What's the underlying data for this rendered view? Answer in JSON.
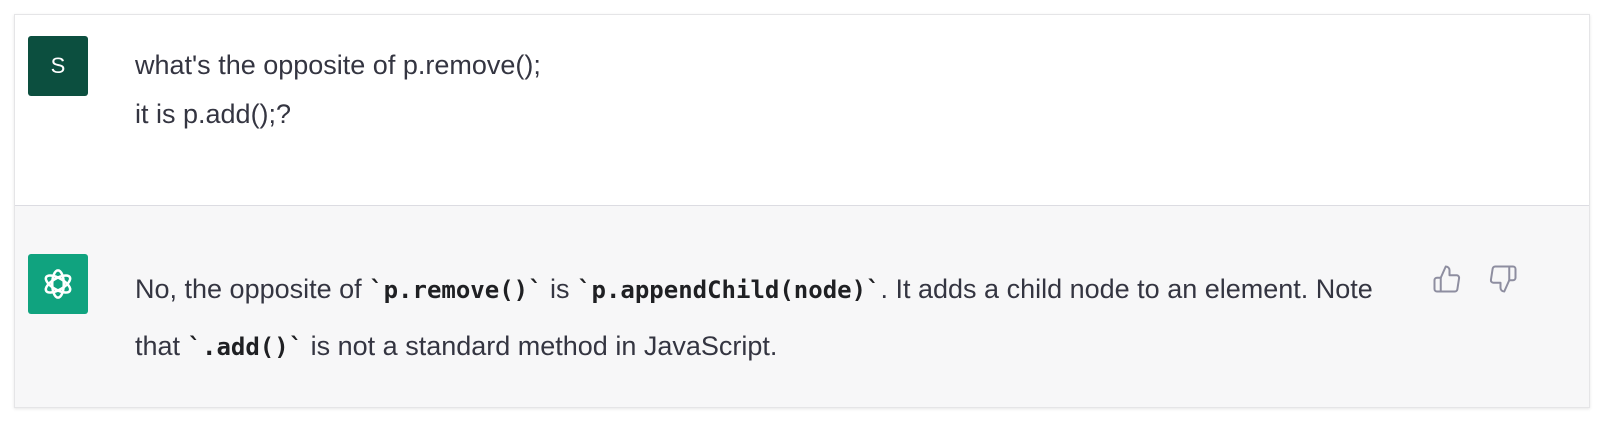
{
  "user_message": {
    "avatar_letter": "S",
    "lines": [
      "what's the opposite of p.remove();",
      "it is p.add();?"
    ]
  },
  "assistant_message": {
    "parts": [
      "No, the opposite of ",
      "`p.remove()`",
      " is ",
      "`p.appendChild(node)`",
      ". It adds a child node to an element. Note that ",
      "`.add()`",
      " is not a standard method in JavaScript."
    ]
  },
  "feedback": {
    "like_icon": "thumbs-up-icon",
    "dislike_icon": "thumbs-down-icon"
  },
  "colors": {
    "user_avatar": "#0c4f3f",
    "assistant_avatar": "#10a37f",
    "assistant_bg": "#f7f7f8",
    "text": "#343541"
  }
}
